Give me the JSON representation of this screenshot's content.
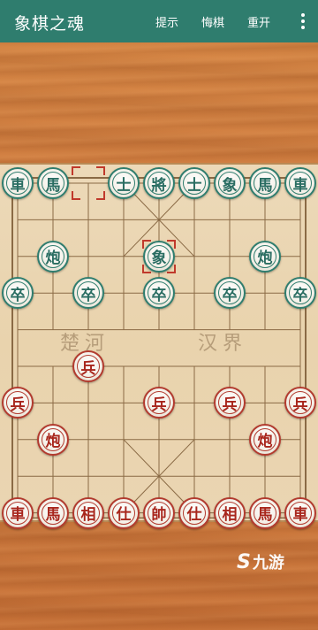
{
  "header": {
    "title": "象棋之魂",
    "menu": [
      {
        "label": "提示"
      },
      {
        "label": "悔棋"
      },
      {
        "label": "重开"
      }
    ]
  },
  "board": {
    "river_left": "楚河",
    "river_right": "汉界",
    "black_pieces": [
      {
        "label": "車",
        "col": 0,
        "row": 0
      },
      {
        "label": "馬",
        "col": 1,
        "row": 0
      },
      {
        "label": "士",
        "col": 3,
        "row": 0
      },
      {
        "label": "將",
        "col": 4,
        "row": 0
      },
      {
        "label": "士",
        "col": 5,
        "row": 0
      },
      {
        "label": "象",
        "col": 6,
        "row": 0
      },
      {
        "label": "馬",
        "col": 7,
        "row": 0
      },
      {
        "label": "車",
        "col": 8,
        "row": 0
      },
      {
        "label": "炮",
        "col": 1,
        "row": 2
      },
      {
        "label": "象",
        "col": 4,
        "row": 2
      },
      {
        "label": "炮",
        "col": 7,
        "row": 2
      },
      {
        "label": "卒",
        "col": 0,
        "row": 3
      },
      {
        "label": "卒",
        "col": 2,
        "row": 3
      },
      {
        "label": "卒",
        "col": 4,
        "row": 3
      },
      {
        "label": "卒",
        "col": 6,
        "row": 3
      },
      {
        "label": "卒",
        "col": 8,
        "row": 3
      }
    ],
    "red_pieces": [
      {
        "label": "兵",
        "col": 2,
        "row": 5
      },
      {
        "label": "兵",
        "col": 0,
        "row": 6
      },
      {
        "label": "兵",
        "col": 4,
        "row": 6
      },
      {
        "label": "兵",
        "col": 6,
        "row": 6
      },
      {
        "label": "兵",
        "col": 8,
        "row": 6
      },
      {
        "label": "炮",
        "col": 1,
        "row": 7
      },
      {
        "label": "炮",
        "col": 7,
        "row": 7
      },
      {
        "label": "車",
        "col": 0,
        "row": 9
      },
      {
        "label": "馬",
        "col": 1,
        "row": 9
      },
      {
        "label": "相",
        "col": 2,
        "row": 9
      },
      {
        "label": "仕",
        "col": 3,
        "row": 9
      },
      {
        "label": "帥",
        "col": 4,
        "row": 9
      },
      {
        "label": "仕",
        "col": 5,
        "row": 9
      },
      {
        "label": "相",
        "col": 6,
        "row": 9
      },
      {
        "label": "馬",
        "col": 7,
        "row": 9
      },
      {
        "label": "車",
        "col": 8,
        "row": 9
      }
    ],
    "last_move": {
      "from": {
        "col": 2,
        "row": 0
      },
      "to": {
        "col": 4,
        "row": 2
      }
    }
  },
  "watermark": {
    "logo": "S",
    "text": "九游"
  },
  "colors": {
    "header_bg": "#2f7d6e",
    "black_piece": "#2f7d6e",
    "red_piece": "#b23a2e",
    "selection": "#c0392b"
  }
}
